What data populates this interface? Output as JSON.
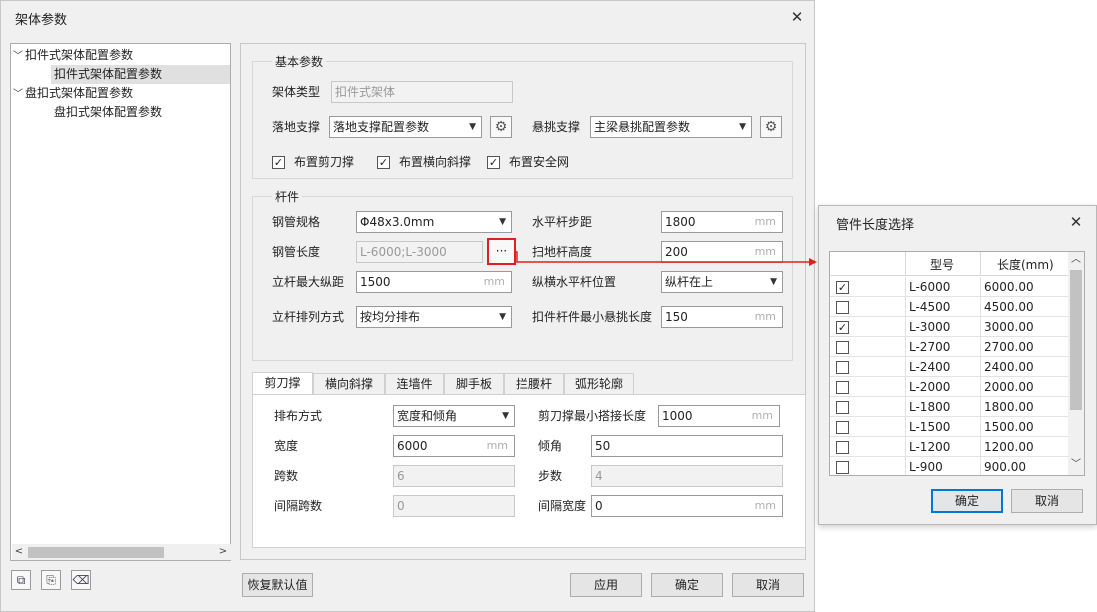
{
  "window": {
    "title": "架体参数",
    "close_glyph": "✕"
  },
  "tree": {
    "items": [
      {
        "label": "扣件式架体配置参数",
        "expanded": true
      },
      {
        "label": "扣件式架体配置参数",
        "selected": true
      },
      {
        "label": "盘扣式架体配置参数",
        "expanded": true
      },
      {
        "label": "盘扣式架体配置参数"
      }
    ]
  },
  "basic": {
    "title": "基本参数",
    "frame_type_label": "架体类型",
    "frame_type_value": "扣件式架体",
    "ground_support_label": "落地支撑",
    "ground_support_value": "落地支撑配置参数",
    "cantilever_label": "悬挑支撑",
    "cantilever_value": "主梁悬挑配置参数",
    "cb_scissor": "布置剪刀撑",
    "cb_lateral": "布置横向斜撑",
    "cb_safety_net": "布置安全网"
  },
  "rod": {
    "title": "杆件",
    "tube_spec_label": "钢管规格",
    "tube_spec_value": "Φ48x3.0mm",
    "tube_len_label": "钢管长度",
    "tube_len_value": "L-6000;L-3000",
    "tube_len_btn": "···",
    "max_pitch_label": "立杆最大纵距",
    "max_pitch_value": "1500",
    "arrange_label": "立杆排列方式",
    "arrange_value": "按均分排布",
    "h_step_label": "水平杆步距",
    "h_step_value": "1800",
    "sweep_label": "扫地杆高度",
    "sweep_value": "200",
    "pos_label": "纵横水平杆位置",
    "pos_value": "纵杆在上",
    "overhang_label": "扣件杆件最小悬挑长度",
    "overhang_value": "150",
    "unit": "mm"
  },
  "tabs": [
    "剪刀撑",
    "横向斜撑",
    "连墙件",
    "脚手板",
    "拦腰杆",
    "弧形轮廓"
  ],
  "scissor": {
    "layout_label": "排布方式",
    "layout_value": "宽度和倾角",
    "min_lap_label": "剪刀撑最小搭接长度",
    "min_lap_value": "1000",
    "width_label": "宽度",
    "width_value": "6000",
    "angle_label": "倾角",
    "angle_value": "50",
    "span_label": "跨数",
    "span_value": "6",
    "step_label": "步数",
    "step_value": "4",
    "gap_span_label": "间隔跨数",
    "gap_span_value": "0",
    "gap_width_label": "间隔宽度",
    "gap_width_value": "0",
    "unit": "mm"
  },
  "footer": {
    "reset": "恢复默认值",
    "apply": "应用",
    "ok": "确定",
    "cancel": "取消"
  },
  "popup": {
    "title": "管件长度选择",
    "col_model": "型号",
    "col_length": "长度(mm)",
    "rows": [
      {
        "checked": true,
        "model": "L-6000",
        "length": "6000.00"
      },
      {
        "checked": false,
        "model": "L-4500",
        "length": "4500.00"
      },
      {
        "checked": true,
        "model": "L-3000",
        "length": "3000.00"
      },
      {
        "checked": false,
        "model": "L-2700",
        "length": "2700.00"
      },
      {
        "checked": false,
        "model": "L-2400",
        "length": "2400.00"
      },
      {
        "checked": false,
        "model": "L-2000",
        "length": "2000.00"
      },
      {
        "checked": false,
        "model": "L-1800",
        "length": "1800.00"
      },
      {
        "checked": false,
        "model": "L-1500",
        "length": "1500.00"
      },
      {
        "checked": false,
        "model": "L-1200",
        "length": "1200.00"
      },
      {
        "checked": false,
        "model": "L-900",
        "length": "900.00"
      }
    ],
    "ok": "确定",
    "cancel": "取消"
  },
  "colors": {
    "highlight": "#e02020",
    "focus": "#0078d7"
  }
}
